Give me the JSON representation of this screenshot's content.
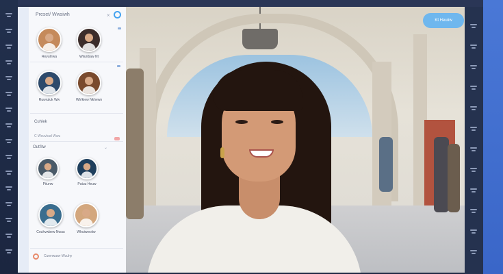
{
  "panel": {
    "title": "Preset/ Wwsiwh",
    "close_glyph": "×",
    "contacts_top": [
      {
        "name": "Reyulnwa",
        "meta": "",
        "avatar_bg": "#c58a5b"
      },
      {
        "name": "Wiiunbaw Nt",
        "meta": "",
        "avatar_bg": "#3b2c2a"
      },
      {
        "name": "Ruwruluk Ww",
        "meta": "",
        "avatar_bg": "#2d4a6b"
      },
      {
        "name": "Wh/kiew Nkhewn",
        "meta": "",
        "avatar_bg": "#7a4a2d"
      }
    ],
    "section_one": "Cuhlek",
    "section_one_sub": "C Wouvkud Wwu",
    "section_two": "Outfitw",
    "contacts_bottom": [
      {
        "name": "Piiunw",
        "meta": "",
        "avatar_bg": "#4a5a68"
      },
      {
        "name": "Putuu Heuw",
        "meta": "",
        "avatar_bg": "#1f3f5d"
      },
      {
        "name": "Couhvwbew Nwuu",
        "meta": "",
        "avatar_bg": "#3a6d8e"
      },
      {
        "name": "Whuiwwoiiw",
        "meta": "",
        "avatar_bg": "#d3a77e"
      }
    ],
    "footer_text": "Cuwnwuwr Wuuhy"
  },
  "video": {
    "pill_label": "Kt  Heuiiw"
  },
  "icons": {
    "left_rail": [
      "menu-icon",
      "chat-icon",
      "settings-icon",
      "grid-icon",
      "bell-icon",
      "user-icon",
      "phone-icon",
      "calendar-icon",
      "folder-icon",
      "star-icon",
      "mail-icon",
      "help-icon",
      "flag-icon",
      "link-icon",
      "share-icon",
      "refresh-icon"
    ],
    "right_rail": [
      "mic-icon",
      "camera-icon",
      "screen-icon",
      "grid-icon",
      "record-icon",
      "chat-icon",
      "people-icon",
      "more-icon",
      "settings-icon",
      "hand-icon",
      "wifi-icon",
      "end-call-icon"
    ]
  }
}
